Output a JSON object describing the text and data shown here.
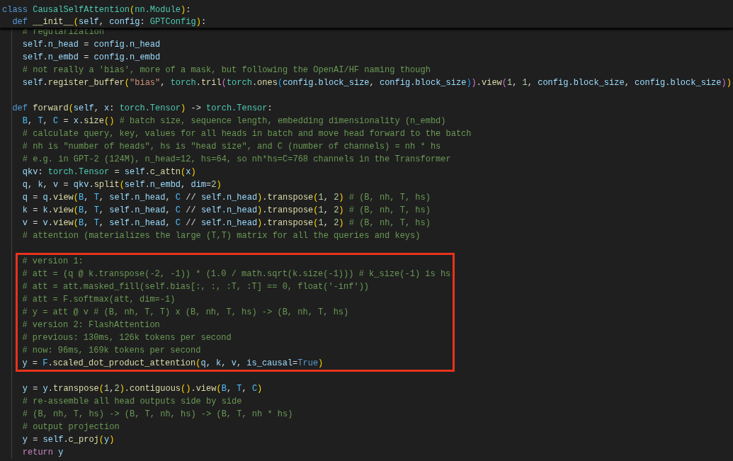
{
  "sticky_scroll": [
    {
      "kind": "line",
      "tokens": [
        {
          "kind": "keyword",
          "text": "class "
        },
        {
          "kind": "type",
          "text": "CausalSelfAttention"
        },
        {
          "kind": "bracket1",
          "text": "("
        },
        {
          "kind": "type",
          "text": "nn.Module"
        },
        {
          "kind": "bracket1",
          "text": ")"
        },
        {
          "kind": "plain",
          "text": ":"
        }
      ],
      "children": [
        {
          "kind": "line",
          "tokens": [
            {
              "kind": "keyword",
              "text": "def "
            },
            {
              "kind": "function",
              "text": "__init__"
            },
            {
              "kind": "bracket1",
              "text": "("
            },
            {
              "kind": "variable",
              "text": "self"
            },
            {
              "kind": "plain",
              "text": ", "
            },
            {
              "kind": "variable",
              "text": "config"
            },
            {
              "kind": "plain",
              "text": ": "
            },
            {
              "kind": "type",
              "text": "GPTConfig"
            },
            {
              "kind": "bracket1",
              "text": ")"
            },
            {
              "kind": "plain",
              "text": ":"
            }
          ]
        }
      ]
    }
  ],
  "editor_lines": [
    {
      "kind": "group",
      "children": [
        {
          "kind": "line",
          "tokens": [
            {
              "kind": "comment",
              "text": "# regularization"
            }
          ]
        },
        {
          "kind": "line",
          "tokens": [
            {
              "kind": "variable",
              "text": "self.n_head"
            },
            {
              "kind": "plain",
              "text": " = "
            },
            {
              "kind": "variable",
              "text": "config.n_head"
            }
          ]
        },
        {
          "kind": "line",
          "tokens": [
            {
              "kind": "variable",
              "text": "self.n_embd"
            },
            {
              "kind": "plain",
              "text": " = "
            },
            {
              "kind": "variable",
              "text": "config.n_embd"
            }
          ]
        },
        {
          "kind": "line",
          "tokens": [
            {
              "kind": "comment",
              "text": "# not really a 'bias', more of a mask, but following the OpenAI/HF naming though"
            }
          ]
        },
        {
          "kind": "line",
          "tokens": [
            {
              "kind": "variable",
              "text": "self"
            },
            {
              "kind": "plain",
              "text": "."
            },
            {
              "kind": "function",
              "text": "register_buffer"
            },
            {
              "kind": "bracket1",
              "text": "("
            },
            {
              "kind": "string",
              "text": "\"bias\""
            },
            {
              "kind": "plain",
              "text": ", "
            },
            {
              "kind": "type",
              "text": "torch"
            },
            {
              "kind": "plain",
              "text": "."
            },
            {
              "kind": "function",
              "text": "tril"
            },
            {
              "kind": "bracket2",
              "text": "("
            },
            {
              "kind": "type",
              "text": "torch"
            },
            {
              "kind": "plain",
              "text": "."
            },
            {
              "kind": "function",
              "text": "ones"
            },
            {
              "kind": "bracket3",
              "text": "("
            },
            {
              "kind": "variable",
              "text": "config.block_size"
            },
            {
              "kind": "plain",
              "text": ", "
            },
            {
              "kind": "variable",
              "text": "config.block_size"
            },
            {
              "kind": "bracket3",
              "text": ")"
            },
            {
              "kind": "bracket2",
              "text": ")"
            },
            {
              "kind": "plain",
              "text": "."
            },
            {
              "kind": "function",
              "text": "view"
            },
            {
              "kind": "bracket2",
              "text": "("
            },
            {
              "kind": "number",
              "text": "1"
            },
            {
              "kind": "plain",
              "text": ", "
            },
            {
              "kind": "number",
              "text": "1"
            },
            {
              "kind": "plain",
              "text": ", "
            },
            {
              "kind": "variable",
              "text": "config.block_size"
            },
            {
              "kind": "plain",
              "text": ", "
            },
            {
              "kind": "variable",
              "text": "config.block_size"
            },
            {
              "kind": "bracket2",
              "text": ")"
            },
            {
              "kind": "bracket1",
              "text": ")"
            }
          ]
        }
      ]
    },
    {
      "kind": "blank"
    },
    {
      "kind": "line",
      "tokens": [
        {
          "kind": "keyword",
          "text": "def "
        },
        {
          "kind": "function",
          "text": "forward"
        },
        {
          "kind": "bracket1",
          "text": "("
        },
        {
          "kind": "variable",
          "text": "self"
        },
        {
          "kind": "plain",
          "text": ", "
        },
        {
          "kind": "variable",
          "text": "x"
        },
        {
          "kind": "plain",
          "text": ": "
        },
        {
          "kind": "type",
          "text": "torch.Tensor"
        },
        {
          "kind": "bracket1",
          "text": ")"
        },
        {
          "kind": "plain",
          "text": " -> "
        },
        {
          "kind": "type",
          "text": "torch.Tensor"
        },
        {
          "kind": "plain",
          "text": ":"
        }
      ],
      "children": [
        {
          "kind": "line",
          "tokens": [
            {
              "kind": "constant",
              "text": "B"
            },
            {
              "kind": "plain",
              "text": ", "
            },
            {
              "kind": "constant",
              "text": "T"
            },
            {
              "kind": "plain",
              "text": ", "
            },
            {
              "kind": "constant",
              "text": "C"
            },
            {
              "kind": "plain",
              "text": " = "
            },
            {
              "kind": "variable",
              "text": "x"
            },
            {
              "kind": "plain",
              "text": "."
            },
            {
              "kind": "function",
              "text": "size"
            },
            {
              "kind": "bracket1",
              "text": "()"
            },
            {
              "kind": "comment",
              "text": " # batch size, sequence length, embedding dimensionality (n_embd)"
            }
          ]
        },
        {
          "kind": "line",
          "tokens": [
            {
              "kind": "comment",
              "text": "# calculate query, key, values for all heads in batch and move head forward to the batch"
            }
          ]
        },
        {
          "kind": "line",
          "tokens": [
            {
              "kind": "comment",
              "text": "# nh is \"number of heads\", hs is \"head size\", and C (number of channels) = nh * hs"
            }
          ]
        },
        {
          "kind": "line",
          "tokens": [
            {
              "kind": "comment",
              "text": "# e.g. in GPT-2 (124M), n_head=12, hs=64, so nh*hs=C=768 channels in the Transformer"
            }
          ]
        },
        {
          "kind": "line",
          "tokens": [
            {
              "kind": "variable",
              "text": "qkv"
            },
            {
              "kind": "plain",
              "text": ": "
            },
            {
              "kind": "type",
              "text": "torch.Tensor"
            },
            {
              "kind": "plain",
              "text": " = "
            },
            {
              "kind": "variable",
              "text": "self"
            },
            {
              "kind": "plain",
              "text": "."
            },
            {
              "kind": "function",
              "text": "c_attn"
            },
            {
              "kind": "bracket1",
              "text": "("
            },
            {
              "kind": "variable",
              "text": "x"
            },
            {
              "kind": "bracket1",
              "text": ")"
            }
          ]
        },
        {
          "kind": "line",
          "tokens": [
            {
              "kind": "variable",
              "text": "q"
            },
            {
              "kind": "plain",
              "text": ", "
            },
            {
              "kind": "variable",
              "text": "k"
            },
            {
              "kind": "plain",
              "text": ", "
            },
            {
              "kind": "variable",
              "text": "v"
            },
            {
              "kind": "plain",
              "text": " = "
            },
            {
              "kind": "variable",
              "text": "qkv"
            },
            {
              "kind": "plain",
              "text": "."
            },
            {
              "kind": "function",
              "text": "split"
            },
            {
              "kind": "bracket1",
              "text": "("
            },
            {
              "kind": "variable",
              "text": "self.n_embd"
            },
            {
              "kind": "plain",
              "text": ", "
            },
            {
              "kind": "variable",
              "text": "dim"
            },
            {
              "kind": "plain",
              "text": "="
            },
            {
              "kind": "number",
              "text": "2"
            },
            {
              "kind": "bracket1",
              "text": ")"
            }
          ]
        },
        {
          "kind": "line",
          "tokens": [
            {
              "kind": "variable",
              "text": "q"
            },
            {
              "kind": "plain",
              "text": " = "
            },
            {
              "kind": "variable",
              "text": "q"
            },
            {
              "kind": "plain",
              "text": "."
            },
            {
              "kind": "function",
              "text": "view"
            },
            {
              "kind": "bracket1",
              "text": "("
            },
            {
              "kind": "constant",
              "text": "B"
            },
            {
              "kind": "plain",
              "text": ", "
            },
            {
              "kind": "constant",
              "text": "T"
            },
            {
              "kind": "plain",
              "text": ", "
            },
            {
              "kind": "variable",
              "text": "self.n_head"
            },
            {
              "kind": "plain",
              "text": ", "
            },
            {
              "kind": "constant",
              "text": "C"
            },
            {
              "kind": "plain",
              "text": " // "
            },
            {
              "kind": "variable",
              "text": "self.n_head"
            },
            {
              "kind": "bracket1",
              "text": ")"
            },
            {
              "kind": "plain",
              "text": "."
            },
            {
              "kind": "function",
              "text": "transpose"
            },
            {
              "kind": "bracket1",
              "text": "("
            },
            {
              "kind": "number",
              "text": "1"
            },
            {
              "kind": "plain",
              "text": ", "
            },
            {
              "kind": "number",
              "text": "2"
            },
            {
              "kind": "bracket1",
              "text": ")"
            },
            {
              "kind": "comment",
              "text": " # (B, nh, T, hs)"
            }
          ]
        },
        {
          "kind": "line",
          "tokens": [
            {
              "kind": "variable",
              "text": "k"
            },
            {
              "kind": "plain",
              "text": " = "
            },
            {
              "kind": "variable",
              "text": "k"
            },
            {
              "kind": "plain",
              "text": "."
            },
            {
              "kind": "function",
              "text": "view"
            },
            {
              "kind": "bracket1",
              "text": "("
            },
            {
              "kind": "constant",
              "text": "B"
            },
            {
              "kind": "plain",
              "text": ", "
            },
            {
              "kind": "constant",
              "text": "T"
            },
            {
              "kind": "plain",
              "text": ", "
            },
            {
              "kind": "variable",
              "text": "self.n_head"
            },
            {
              "kind": "plain",
              "text": ", "
            },
            {
              "kind": "constant",
              "text": "C"
            },
            {
              "kind": "plain",
              "text": " // "
            },
            {
              "kind": "variable",
              "text": "self.n_head"
            },
            {
              "kind": "bracket1",
              "text": ")"
            },
            {
              "kind": "plain",
              "text": "."
            },
            {
              "kind": "function",
              "text": "transpose"
            },
            {
              "kind": "bracket1",
              "text": "("
            },
            {
              "kind": "number",
              "text": "1"
            },
            {
              "kind": "plain",
              "text": ", "
            },
            {
              "kind": "number",
              "text": "2"
            },
            {
              "kind": "bracket1",
              "text": ")"
            },
            {
              "kind": "comment",
              "text": " # (B, nh, T, hs)"
            }
          ]
        },
        {
          "kind": "line",
          "tokens": [
            {
              "kind": "variable",
              "text": "v"
            },
            {
              "kind": "plain",
              "text": " = "
            },
            {
              "kind": "variable",
              "text": "v"
            },
            {
              "kind": "plain",
              "text": "."
            },
            {
              "kind": "function",
              "text": "view"
            },
            {
              "kind": "bracket1",
              "text": "("
            },
            {
              "kind": "constant",
              "text": "B"
            },
            {
              "kind": "plain",
              "text": ", "
            },
            {
              "kind": "constant",
              "text": "T"
            },
            {
              "kind": "plain",
              "text": ", "
            },
            {
              "kind": "variable",
              "text": "self.n_head"
            },
            {
              "kind": "plain",
              "text": ", "
            },
            {
              "kind": "constant",
              "text": "C"
            },
            {
              "kind": "plain",
              "text": " // "
            },
            {
              "kind": "variable",
              "text": "self.n_head"
            },
            {
              "kind": "bracket1",
              "text": ")"
            },
            {
              "kind": "plain",
              "text": "."
            },
            {
              "kind": "function",
              "text": "transpose"
            },
            {
              "kind": "bracket1",
              "text": "("
            },
            {
              "kind": "number",
              "text": "1"
            },
            {
              "kind": "plain",
              "text": ", "
            },
            {
              "kind": "number",
              "text": "2"
            },
            {
              "kind": "bracket1",
              "text": ")"
            },
            {
              "kind": "comment",
              "text": " # (B, nh, T, hs)"
            }
          ]
        },
        {
          "kind": "line",
          "tokens": [
            {
              "kind": "comment",
              "text": "# attention (materializes the large (T,T) matrix for all the queries and keys)"
            }
          ]
        },
        {
          "kind": "blank"
        },
        {
          "kind": "highlight",
          "children": [
            {
              "kind": "line",
              "tokens": [
                {
                  "kind": "comment",
                  "text": "# version 1:"
                }
              ]
            },
            {
              "kind": "line",
              "tokens": [
                {
                  "kind": "comment",
                  "text": "# att = (q @ k.transpose(-2, -1)) * (1.0 / math.sqrt(k.size(-1))) # k_size(-1) is hs"
                }
              ]
            },
            {
              "kind": "line",
              "tokens": [
                {
                  "kind": "comment",
                  "text": "# att = att.masked_fill(self.bias[:, :, :T, :T] == 0, float('-inf'))"
                }
              ]
            },
            {
              "kind": "line",
              "tokens": [
                {
                  "kind": "comment",
                  "text": "# att = F.softmax(att, dim=-1)"
                }
              ]
            },
            {
              "kind": "line",
              "tokens": [
                {
                  "kind": "comment",
                  "text": "# y = att @ v # (B, nh, T, T) x (B, nh, T, hs) -> (B, nh, T, hs)"
                }
              ]
            },
            {
              "kind": "line",
              "tokens": [
                {
                  "kind": "comment",
                  "text": "# version 2: FlashAttention"
                }
              ]
            },
            {
              "kind": "line",
              "tokens": [
                {
                  "kind": "comment",
                  "text": "# previous: 130ms, 126k tokens per second"
                }
              ]
            },
            {
              "kind": "line",
              "tokens": [
                {
                  "kind": "comment",
                  "text": "# now: 96ms, 169k tokens per second"
                }
              ]
            },
            {
              "kind": "line",
              "tokens": [
                {
                  "kind": "variable",
                  "text": "y"
                },
                {
                  "kind": "plain",
                  "text": " = "
                },
                {
                  "kind": "constant",
                  "text": "F"
                },
                {
                  "kind": "plain",
                  "text": "."
                },
                {
                  "kind": "function",
                  "text": "scaled_dot_product_attention"
                },
                {
                  "kind": "bracket1",
                  "text": "("
                },
                {
                  "kind": "variable",
                  "text": "q"
                },
                {
                  "kind": "plain",
                  "text": ", "
                },
                {
                  "kind": "variable",
                  "text": "k"
                },
                {
                  "kind": "plain",
                  "text": ", "
                },
                {
                  "kind": "variable",
                  "text": "v"
                },
                {
                  "kind": "plain",
                  "text": ", "
                },
                {
                  "kind": "variable",
                  "text": "is_causal"
                },
                {
                  "kind": "plain",
                  "text": "="
                },
                {
                  "kind": "keyword",
                  "text": "True"
                },
                {
                  "kind": "bracket1",
                  "text": ")"
                }
              ]
            }
          ]
        },
        {
          "kind": "blank"
        },
        {
          "kind": "line",
          "tokens": [
            {
              "kind": "variable",
              "text": "y"
            },
            {
              "kind": "plain",
              "text": " = "
            },
            {
              "kind": "variable",
              "text": "y"
            },
            {
              "kind": "plain",
              "text": "."
            },
            {
              "kind": "function",
              "text": "transpose"
            },
            {
              "kind": "bracket1",
              "text": "("
            },
            {
              "kind": "number",
              "text": "1"
            },
            {
              "kind": "plain",
              "text": ","
            },
            {
              "kind": "number",
              "text": "2"
            },
            {
              "kind": "bracket1",
              "text": ")"
            },
            {
              "kind": "plain",
              "text": "."
            },
            {
              "kind": "function",
              "text": "contiguous"
            },
            {
              "kind": "bracket1",
              "text": "()"
            },
            {
              "kind": "plain",
              "text": "."
            },
            {
              "kind": "function",
              "text": "view"
            },
            {
              "kind": "bracket1",
              "text": "("
            },
            {
              "kind": "constant",
              "text": "B"
            },
            {
              "kind": "plain",
              "text": ", "
            },
            {
              "kind": "constant",
              "text": "T"
            },
            {
              "kind": "plain",
              "text": ", "
            },
            {
              "kind": "constant",
              "text": "C"
            },
            {
              "kind": "bracket1",
              "text": ")"
            }
          ]
        },
        {
          "kind": "line",
          "tokens": [
            {
              "kind": "comment",
              "text": "# re-assemble all head outputs side by side"
            }
          ]
        },
        {
          "kind": "line",
          "tokens": [
            {
              "kind": "comment",
              "text": "# (B, nh, T, hs) -> (B, T, nh, hs) -> (B, T, nh * hs)"
            }
          ]
        },
        {
          "kind": "line",
          "tokens": [
            {
              "kind": "comment",
              "text": "# output projection"
            }
          ]
        },
        {
          "kind": "line",
          "tokens": [
            {
              "kind": "variable",
              "text": "y"
            },
            {
              "kind": "plain",
              "text": " = "
            },
            {
              "kind": "variable",
              "text": "self"
            },
            {
              "kind": "plain",
              "text": "."
            },
            {
              "kind": "function",
              "text": "c_proj"
            },
            {
              "kind": "bracket1",
              "text": "("
            },
            {
              "kind": "variable",
              "text": "y"
            },
            {
              "kind": "bracket1",
              "text": ")"
            }
          ]
        },
        {
          "kind": "line",
          "tokens": [
            {
              "kind": "control",
              "text": "return "
            },
            {
              "kind": "variable",
              "text": "y"
            }
          ]
        }
      ]
    }
  ]
}
